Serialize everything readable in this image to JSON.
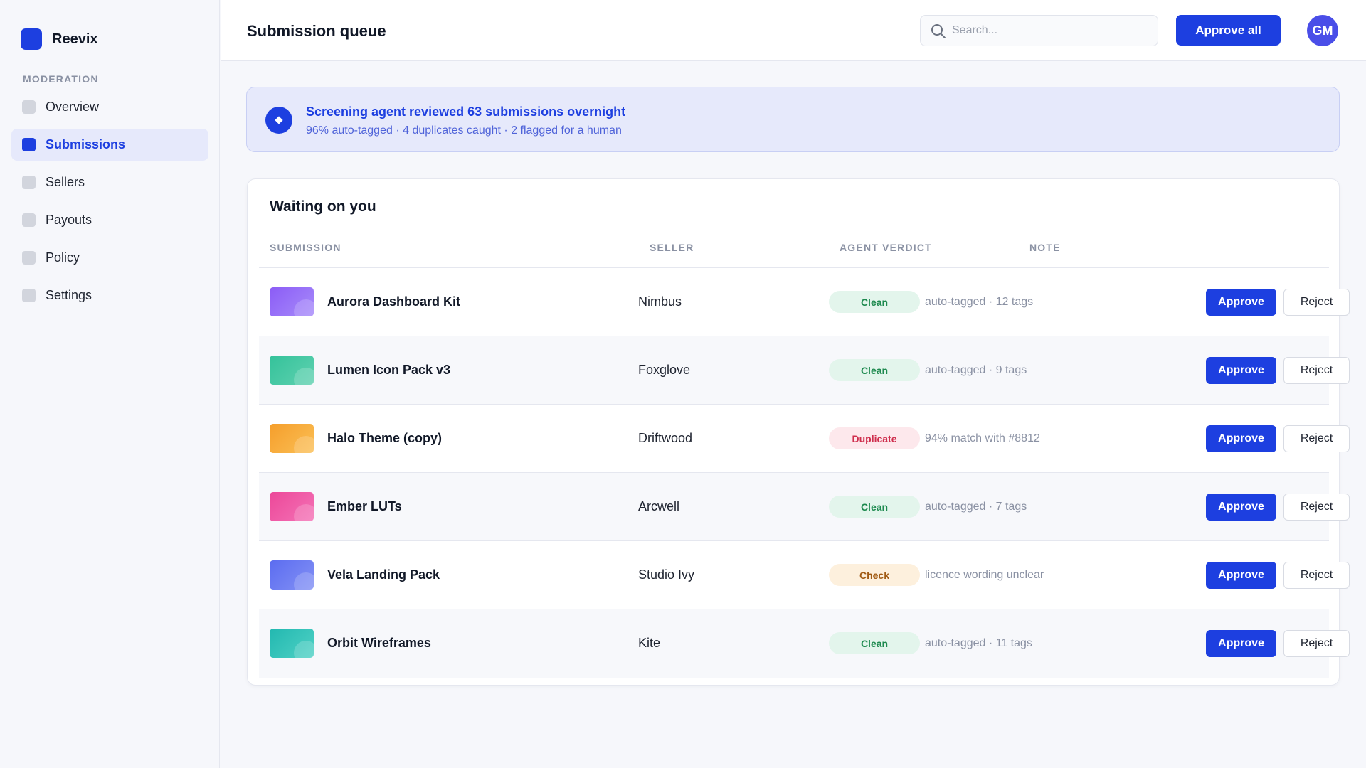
{
  "app": {
    "name": "Reevix"
  },
  "sidebar": {
    "section_label": "MODERATION",
    "items": [
      {
        "label": "Overview",
        "active": false
      },
      {
        "label": "Submissions",
        "active": true
      },
      {
        "label": "Sellers",
        "active": false
      },
      {
        "label": "Payouts",
        "active": false
      },
      {
        "label": "Policy",
        "active": false
      },
      {
        "label": "Settings",
        "active": false
      }
    ]
  },
  "header": {
    "title": "Submission queue",
    "search_placeholder": "Search...",
    "approve_all_label": "Approve all",
    "avatar_initials": "GM"
  },
  "banner": {
    "title": "Screening agent reviewed 63 submissions overnight",
    "subtitle": "96% auto-tagged · 4 duplicates caught · 2 flagged for a human"
  },
  "table": {
    "title": "Waiting on you",
    "columns": [
      "SUBMISSION",
      "SELLER",
      "AGENT VERDICT",
      "NOTE"
    ],
    "approve_label": "Approve",
    "reject_label": "Reject",
    "rows": [
      {
        "submission": "Aurora Dashboard Kit",
        "seller": "Nimbus",
        "verdict": "Clean",
        "verdict_kind": "clean",
        "note": "auto-tagged · 12 tags",
        "thumb_colors": [
          "#8b5cf6",
          "#a78bfa"
        ]
      },
      {
        "submission": "Lumen Icon Pack v3",
        "seller": "Foxglove",
        "verdict": "Clean",
        "verdict_kind": "clean",
        "note": "auto-tagged · 9 tags",
        "thumb_colors": [
          "#34c29a",
          "#5fd1b0"
        ]
      },
      {
        "submission": "Halo Theme (copy)",
        "seller": "Driftwood",
        "verdict": "Duplicate",
        "verdict_kind": "dup",
        "note": "94% match with #8812",
        "thumb_colors": [
          "#f59e2b",
          "#fbbf55"
        ]
      },
      {
        "submission": "Ember LUTs",
        "seller": "Arcwell",
        "verdict": "Clean",
        "verdict_kind": "clean",
        "note": "auto-tagged · 7 tags",
        "thumb_colors": [
          "#ec4899",
          "#f472b6"
        ]
      },
      {
        "submission": "Vela Landing Pack",
        "seller": "Studio Ivy",
        "verdict": "Check",
        "verdict_kind": "check",
        "note": "licence wording unclear",
        "thumb_colors": [
          "#5b6cf0",
          "#8391f5"
        ]
      },
      {
        "submission": "Orbit Wireframes",
        "seller": "Kite",
        "verdict": "Clean",
        "verdict_kind": "clean",
        "note": "auto-tagged · 11 tags",
        "thumb_colors": [
          "#22b8b0",
          "#4fd1c5"
        ]
      }
    ]
  }
}
